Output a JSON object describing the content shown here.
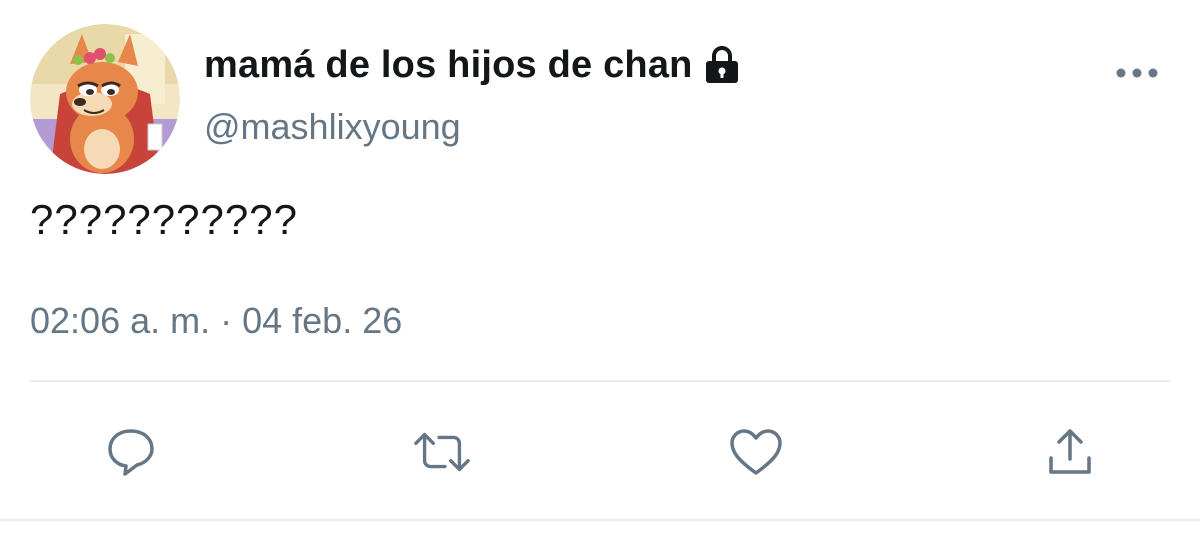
{
  "tweet": {
    "display_name": "mamá de los hijos de chan",
    "handle": "@mashlixyoung",
    "text": "???????????",
    "timestamp": "02:06 a. m. · 04 feb. 26",
    "verified_icon": "lock-icon"
  },
  "actions": [
    {
      "name": "reply",
      "icon": "reply-icon"
    },
    {
      "name": "retweet",
      "icon": "retweet-icon"
    },
    {
      "name": "like",
      "icon": "heart-icon"
    },
    {
      "name": "share",
      "icon": "share-icon"
    }
  ],
  "colors": {
    "text_primary": "#14171a",
    "text_secondary": "#657786",
    "divider": "#e6ecf0",
    "icon": "#657786"
  }
}
